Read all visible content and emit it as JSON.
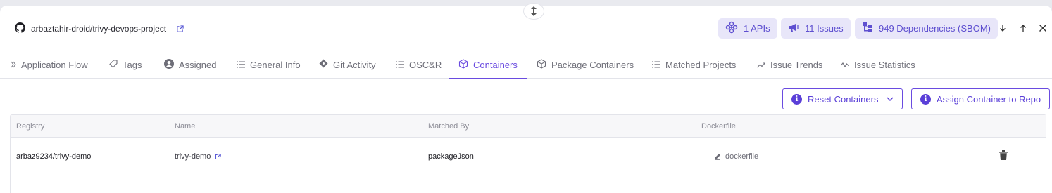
{
  "header": {
    "repo_name": "arbaztahir-droid/trivy-devops-project",
    "apis_label": "1 APIs",
    "issues_label": "11 Issues",
    "dependencies_label": "949 Dependencies (SBOM)"
  },
  "tabs": [
    {
      "label": "Application Flow",
      "icon": "chevron-double-right-icon"
    },
    {
      "label": "Tags",
      "icon": "tag-icon"
    },
    {
      "label": "Assigned",
      "icon": "user-circle-icon"
    },
    {
      "label": "General Info",
      "icon": "list-icon"
    },
    {
      "label": "Git Activity",
      "icon": "git-icon"
    },
    {
      "label": "OSC&R",
      "icon": "list-icon"
    },
    {
      "label": "Containers",
      "icon": "cube-icon",
      "active": true
    },
    {
      "label": "Package Containers",
      "icon": "cube-icon"
    },
    {
      "label": "Matched Projects",
      "icon": "list-icon"
    },
    {
      "label": "Issue Trends",
      "icon": "trend-up-icon"
    },
    {
      "label": "Issue Statistics",
      "icon": "wave-icon"
    }
  ],
  "actions": {
    "reset_label": "Reset Containers",
    "assign_label": "Assign Container to Repo"
  },
  "table": {
    "columns": [
      "Registry",
      "Name",
      "Matched By",
      "Dockerfile"
    ],
    "rows": [
      {
        "registry": "arbaz9234/trivy-demo",
        "name": "trivy-demo",
        "matched_by": "packageJson",
        "dockerfile": "dockerfile"
      }
    ]
  },
  "colors": {
    "accent": "#6a4be0",
    "pill_bg": "#e8e6f9"
  }
}
